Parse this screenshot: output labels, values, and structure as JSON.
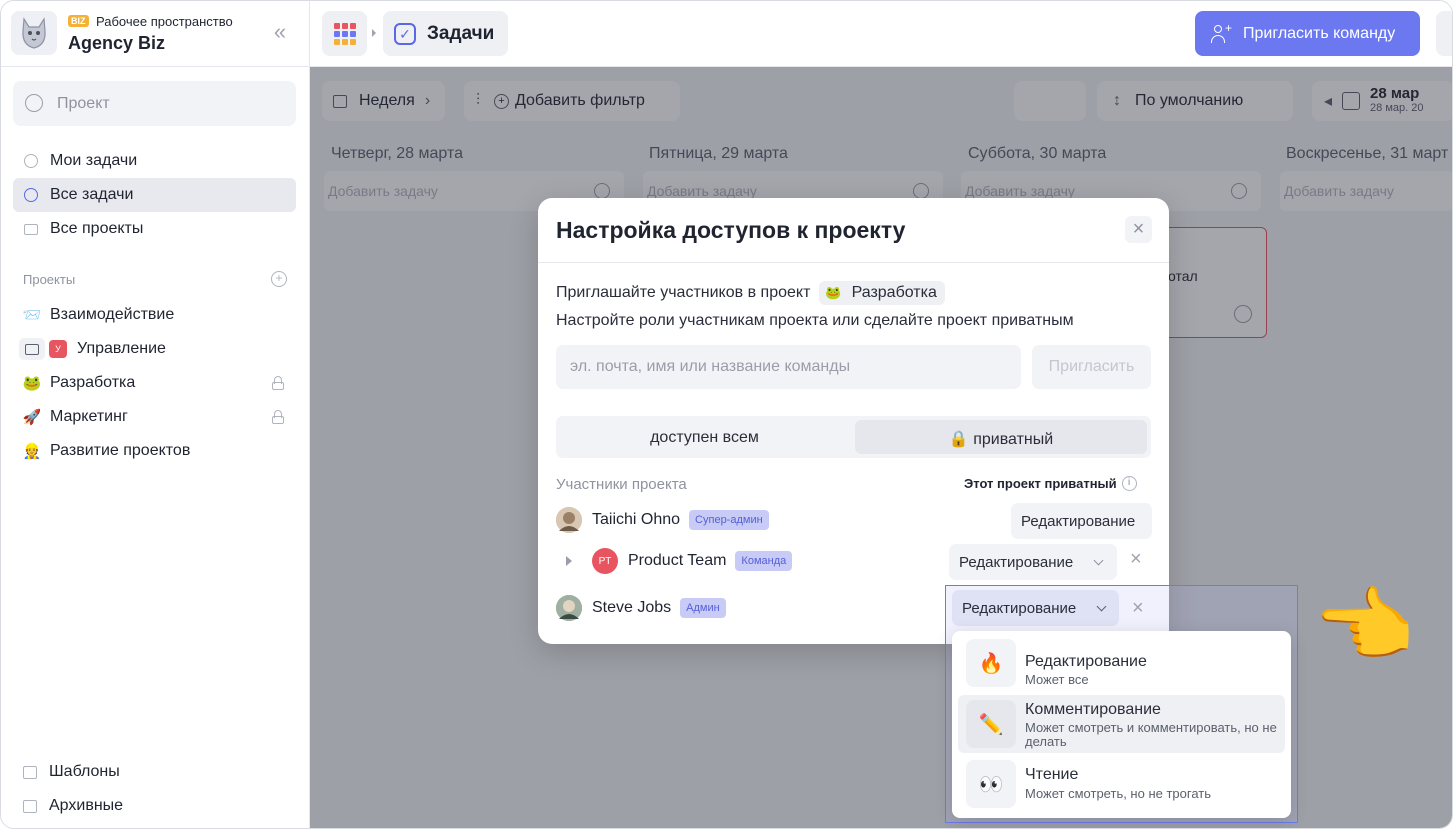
{
  "workspace": {
    "badge": "BIZ",
    "label": "Рабочее пространство",
    "name": "Agency Biz"
  },
  "sidebar": {
    "search_placeholder": "Проект",
    "nav": [
      {
        "label": "Мои задачи"
      },
      {
        "label": "Все задачи",
        "active": true
      },
      {
        "label": "Все проекты"
      }
    ],
    "projects_label": "Проекты",
    "projects": [
      {
        "emoji": "📨",
        "label": "Взаимодействие"
      },
      {
        "badge": "У",
        "label": "Управление"
      },
      {
        "emoji": "🐸",
        "label": "Разработка",
        "locked": true
      },
      {
        "emoji": "🚀",
        "label": "Маркетинг",
        "locked": true
      },
      {
        "emoji": "👷",
        "label": "Развитие проектов"
      }
    ],
    "bottom": [
      {
        "label": "Шаблоны"
      },
      {
        "label": "Архивные"
      }
    ]
  },
  "topbar": {
    "breadcrumb": "Задачи",
    "invite_button": "Пригласить команду"
  },
  "board": {
    "period": "Неделя",
    "add_filter": "Добавить фильтр",
    "sort": "По умолчанию",
    "date_main": "28 мар",
    "date_sub": "28 мар. 20",
    "columns": [
      {
        "title": "Четверг, 28 марта",
        "add": "Добавить задачу"
      },
      {
        "title": "Пятница, 29 марта",
        "add": "Добавить задачу"
      },
      {
        "title": "Суббота, 30 марта",
        "add": "Добавить задачу"
      },
      {
        "title": "Воскресенье, 31 март",
        "add": "Добавить задачу"
      }
    ],
    "card_fragment": "отал"
  },
  "modal": {
    "title": "Настройка доступов к проекту",
    "invite_text": "Приглашайте участников в проект",
    "project_emoji": "🐸",
    "project_name": "Разработка",
    "roles_text": "Настройте роли участникам проекта или сделайте проект приватным",
    "email_placeholder": "эл. почта, имя или название команды",
    "invite_submit": "Пригласить",
    "visibility_public": "доступен всем",
    "visibility_private": "🔒 приватный",
    "members_label": "Участники проекта",
    "private_note": "Этот проект приватный",
    "members": [
      {
        "name": "Taiichi Ohno",
        "tag": "Супер-админ",
        "role": "Редактирование"
      },
      {
        "initials": "PT",
        "name": "Product Team",
        "tag": "Команда",
        "role": "Редактирование"
      },
      {
        "name": "Steve Jobs",
        "tag": "Админ",
        "role": "Редактирование"
      }
    ]
  },
  "role_dropdown": {
    "options": [
      {
        "icon": "🔥",
        "title": "Редактирование",
        "desc": "Может все"
      },
      {
        "icon": "✏️",
        "title": "Комментирование",
        "desc": "Может смотреть и комментировать, но не делать"
      },
      {
        "icon": "👀",
        "title": "Чтение",
        "desc": "Может смотреть, но не трогать"
      }
    ]
  },
  "pointer_emoji": "👈",
  "colors": {
    "accent": "#6b78f0",
    "tag_bg": "#c8cbf6",
    "danger": "#e8545f"
  }
}
